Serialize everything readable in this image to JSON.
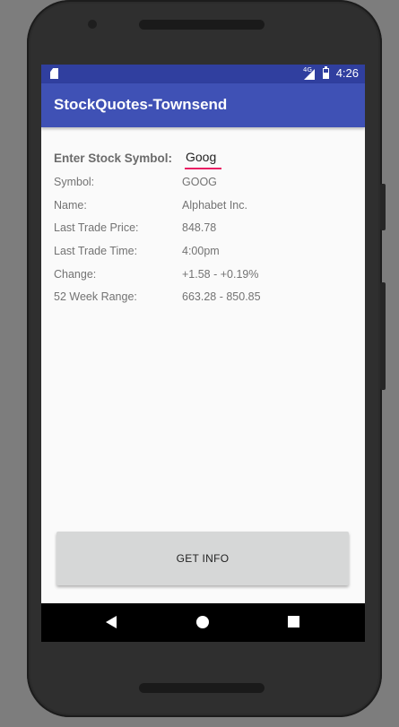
{
  "status_bar": {
    "network": "4G",
    "time": "4:26"
  },
  "app_bar": {
    "title": "StockQuotes-Townsend"
  },
  "form": {
    "entry_label": "Enter Stock Symbol:",
    "symbol_value": "Goog"
  },
  "details": [
    {
      "label": "Symbol:",
      "value": "GOOG"
    },
    {
      "label": "Name:",
      "value": "Alphabet Inc."
    },
    {
      "label": "Last Trade Price:",
      "value": "848.78"
    },
    {
      "label": "Last Trade Time:",
      "value": "4:00pm"
    },
    {
      "label": "Change:",
      "value": "+1.58 - +0.19%"
    },
    {
      "label": "52 Week Range:",
      "value": "663.28 - 850.85"
    }
  ],
  "button": {
    "get_info_label": "GET INFO"
  },
  "colors": {
    "status_bar": "#303f9f",
    "app_bar": "#3f51b5",
    "input_underline": "#e91e63",
    "button_bg": "#d6d7d7"
  }
}
